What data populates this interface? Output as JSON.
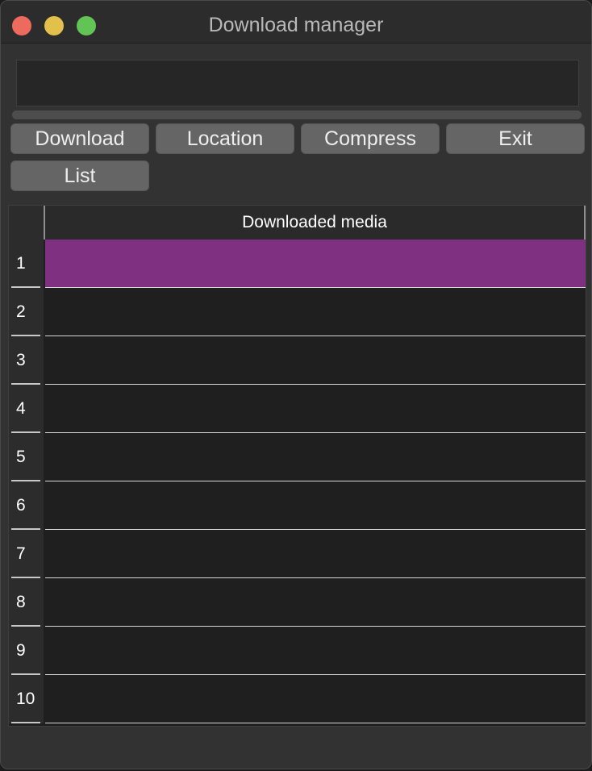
{
  "window": {
    "title": "Download manager"
  },
  "url_field": {
    "value": "",
    "placeholder": ""
  },
  "progress": {
    "fraction": 0
  },
  "buttons": {
    "download": "Download",
    "location": "Location",
    "compress": "Compress",
    "exit": "Exit",
    "list": "List"
  },
  "table": {
    "column_header": "Downloaded media",
    "rows": [
      {
        "number": "1",
        "value": ""
      },
      {
        "number": "2",
        "value": ""
      },
      {
        "number": "3",
        "value": ""
      },
      {
        "number": "4",
        "value": ""
      },
      {
        "number": "5",
        "value": ""
      },
      {
        "number": "6",
        "value": ""
      },
      {
        "number": "7",
        "value": ""
      },
      {
        "number": "8",
        "value": ""
      },
      {
        "number": "9",
        "value": ""
      },
      {
        "number": "10",
        "value": ""
      }
    ],
    "selected_row": 1
  },
  "colors": {
    "selection": "#803080",
    "button": "#656565",
    "window_background": "#323232",
    "close": "#ed6a5e",
    "minimize": "#e2c04a",
    "zoom": "#61c454"
  }
}
